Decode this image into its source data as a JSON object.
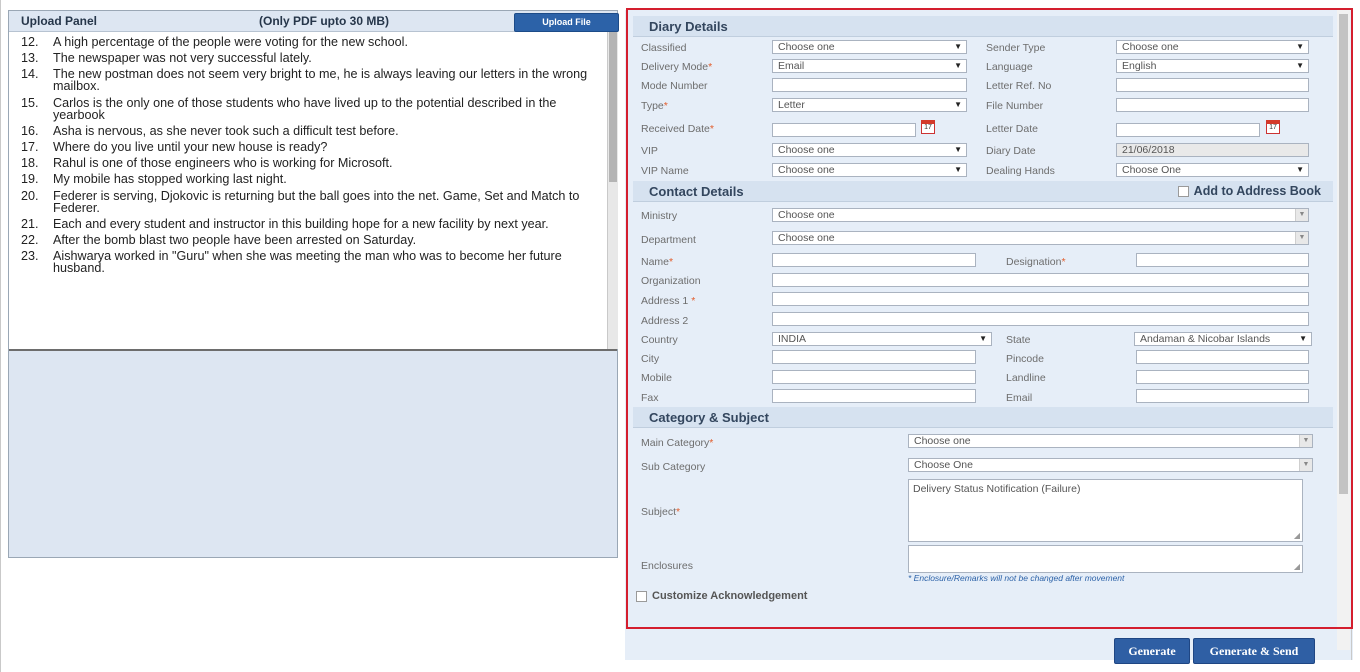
{
  "upload_panel": {
    "title": "Upload Panel",
    "note": "(Only PDF upto 30 MB)",
    "upload_button": "Upload File",
    "document_lines": [
      {
        "num": "12.",
        "text": "A high percentage of the people were voting for the new school."
      },
      {
        "num": "13.",
        "text": "The newspaper was not very successful lately."
      },
      {
        "num": "14.",
        "text": "The new postman does not seem very bright to me, he is always leaving our letters in the wrong mailbox."
      },
      {
        "num": "15.",
        "text": "Carlos is the only one of those students who have lived up to the potential described in the yearbook"
      },
      {
        "num": "16.",
        "text": "Asha is nervous, as she never took such a difficult test before."
      },
      {
        "num": "17.",
        "text": "Where do you live until your new house is ready?"
      },
      {
        "num": "18.",
        "text": "Rahul is one of those engineers who is working for Microsoft."
      },
      {
        "num": "19.",
        "text": "My mobile has stopped working last night."
      },
      {
        "num": "20.",
        "text": "Federer is serving, Djokovic is returning but the ball goes into the net. Game, Set and Match to Federer."
      },
      {
        "num": "21.",
        "text": "Each and every student and instructor in this building hope for a new facility by next year."
      },
      {
        "num": "22.",
        "text": "After the bomb blast two people have been arrested on Saturday."
      },
      {
        "num": "23.",
        "text": "Aishwarya worked in \"Guru\" when she was meeting the man who was to become her future husband."
      }
    ]
  },
  "diary_details": {
    "header": "Diary Details",
    "classified": {
      "label": "Classified",
      "value": "Choose one"
    },
    "sender_type": {
      "label": "Sender Type",
      "value": "Choose one"
    },
    "delivery_mode": {
      "label": "Delivery Mode",
      "value": "Email"
    },
    "language": {
      "label": "Language",
      "value": "English"
    },
    "mode_number": {
      "label": "Mode Number",
      "value": ""
    },
    "letter_ref_no": {
      "label": "Letter Ref. No",
      "value": ""
    },
    "type": {
      "label": "Type",
      "value": "Letter"
    },
    "file_number": {
      "label": "File Number",
      "value": ""
    },
    "received_date": {
      "label": "Received Date",
      "value": ""
    },
    "letter_date": {
      "label": "Letter Date",
      "value": ""
    },
    "vip": {
      "label": "VIP",
      "value": "Choose one"
    },
    "diary_date": {
      "label": "Diary Date",
      "value": "21/06/2018"
    },
    "vip_name": {
      "label": "VIP Name",
      "value": "Choose one"
    },
    "dealing_hands": {
      "label": "Dealing Hands",
      "value": "Choose One"
    },
    "calendar_day": "17"
  },
  "contact_details": {
    "header": "Contact Details",
    "add_to_address_book": "Add to Address Book",
    "ministry": {
      "label": "Ministry",
      "value": "Choose one"
    },
    "department": {
      "label": "Department",
      "value": "Choose one"
    },
    "name": {
      "label": "Name",
      "value": ""
    },
    "designation": {
      "label": "Designation",
      "value": ""
    },
    "organization": {
      "label": "Organization",
      "value": ""
    },
    "address1": {
      "label": "Address 1",
      "value": ""
    },
    "address2": {
      "label": "Address 2",
      "value": ""
    },
    "country": {
      "label": "Country",
      "value": "INDIA"
    },
    "state": {
      "label": "State",
      "value": "Andaman & Nicobar Islands"
    },
    "city": {
      "label": "City",
      "value": ""
    },
    "pincode": {
      "label": "Pincode",
      "value": ""
    },
    "mobile": {
      "label": "Mobile",
      "value": ""
    },
    "landline": {
      "label": "Landline",
      "value": ""
    },
    "fax": {
      "label": "Fax",
      "value": ""
    },
    "email": {
      "label": "Email",
      "value": ""
    }
  },
  "category_subject": {
    "header": "Category & Subject",
    "main_category": {
      "label": "Main Category",
      "value": "Choose one"
    },
    "sub_category": {
      "label": "Sub Category",
      "value": "Choose One"
    },
    "subject": {
      "label": "Subject",
      "value": "Delivery Status Notification (Failure)"
    },
    "enclosures": {
      "label": "Enclosures",
      "value": ""
    },
    "enclosure_note": "* Enclosure/Remarks will not be changed after movement",
    "customize_ack": "Customize Acknowledgement"
  },
  "actions": {
    "generate": "Generate",
    "generate_send": "Generate & Send"
  },
  "colors": {
    "accent": "#2f5fa4",
    "highlight_border": "#d41e2e",
    "required_mark": "#e25c2b"
  }
}
